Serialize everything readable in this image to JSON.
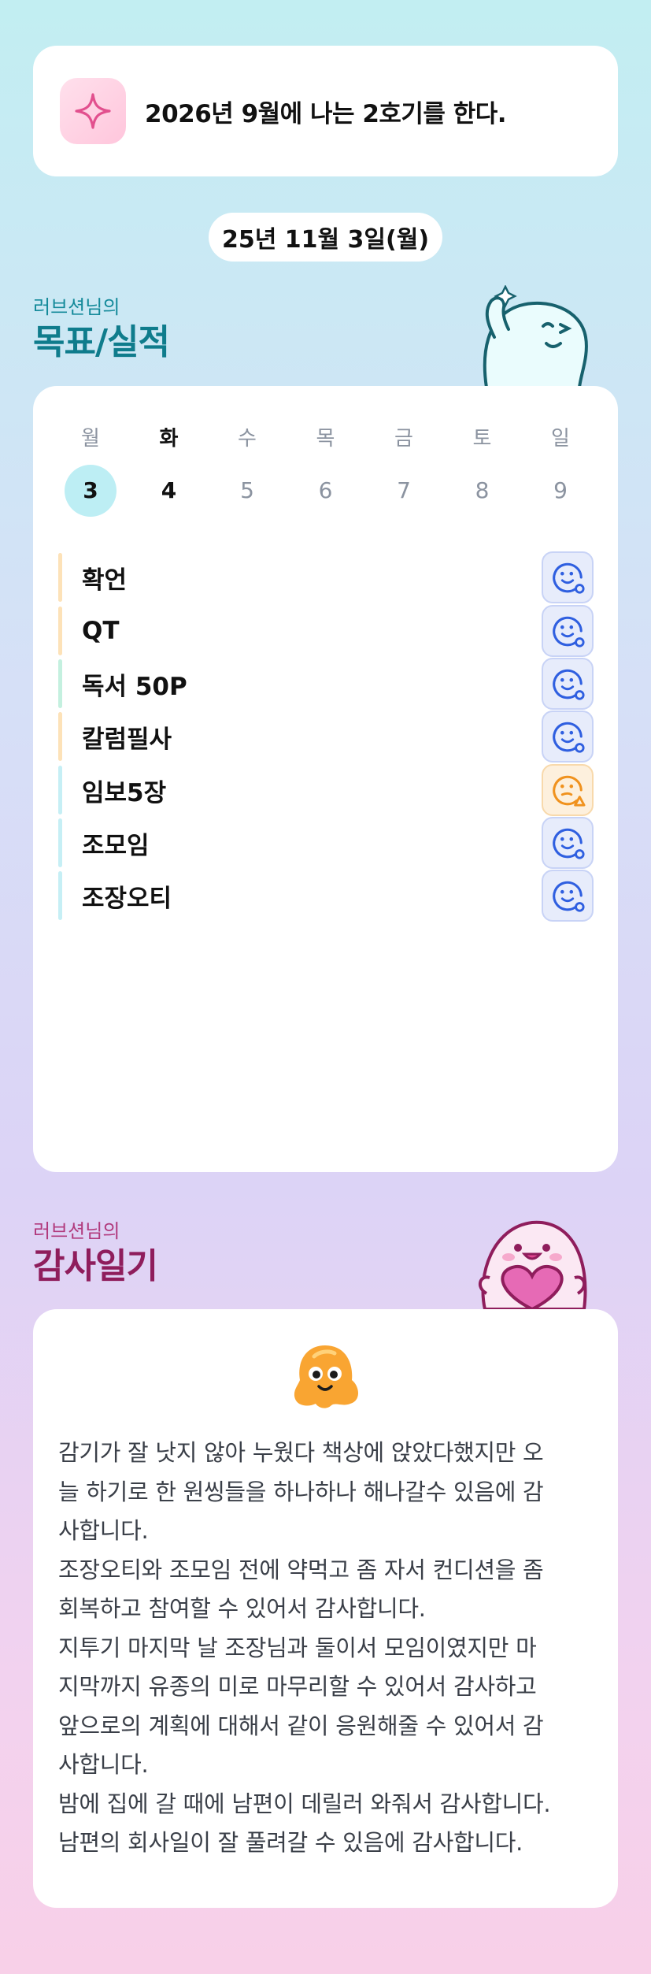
{
  "goal": {
    "text": "2026년 9월에 나는 2호기를 한다.",
    "icon": "sparkle-icon"
  },
  "date": "25년 11월 3일(월)",
  "goals_section": {
    "subtitle": "러브션님의",
    "title": "목표/실적"
  },
  "calendar": {
    "weekdays": [
      "월",
      "화",
      "수",
      "목",
      "금",
      "토",
      "일"
    ],
    "days": [
      "3",
      "4",
      "5",
      "6",
      "7",
      "8",
      "9"
    ],
    "selected_index": 0
  },
  "tasks": [
    {
      "label": "확언",
      "bar_color": "#fde2b8",
      "status": "smile-icon",
      "tone": "blue"
    },
    {
      "label": "QT",
      "bar_color": "#fde2b8",
      "status": "smile-icon",
      "tone": "blue"
    },
    {
      "label": "독서 50P",
      "bar_color": "#c4f0df",
      "status": "smile-icon",
      "tone": "blue"
    },
    {
      "label": "칼럼필사",
      "bar_color": "#fde2b8",
      "status": "smile-icon",
      "tone": "blue"
    },
    {
      "label": "임보5장",
      "bar_color": "#c6eff5",
      "status": "warning-face-icon",
      "tone": "orange"
    },
    {
      "label": "조모임",
      "bar_color": "#c6eff5",
      "status": "smile-icon",
      "tone": "blue"
    },
    {
      "label": "조장오티",
      "bar_color": "#c6eff5",
      "status": "smile-icon",
      "tone": "blue"
    }
  ],
  "gratitude_section": {
    "subtitle": "러브션님의",
    "title": "감사일기"
  },
  "gratitude": {
    "lines": [
      "감기가 잘 낫지 않아 누웠다 책상에 앉았다했지만 오",
      "늘 하기로 한 원씽들을 하나하나 해나갈수 있음에 감",
      "사합니다.",
      "조장오티와 조모임 전에 약먹고 좀 자서 컨디션을 좀",
      "회복하고 참여할 수 있어서 감사합니다.",
      "지투기 마지막 날 조장님과 둘이서 모임이였지만 마",
      "지막까지 유종의 미로 마무리할 수 있어서 감사하고",
      "앞으로의 계획에 대해서 같이 응원해줄 수 있어서 감",
      "사합니다.",
      "밤에 집에 갈 때에 남편이 데릴러 와줘서 감사합니다.",
      "남편의 회사일이 잘 풀려갈 수 있음에 감사합니다."
    ]
  },
  "colors": {
    "accent_teal": "#0f7c8c",
    "accent_pink": "#8f1d5c",
    "selected_day": "#bdeef4"
  }
}
